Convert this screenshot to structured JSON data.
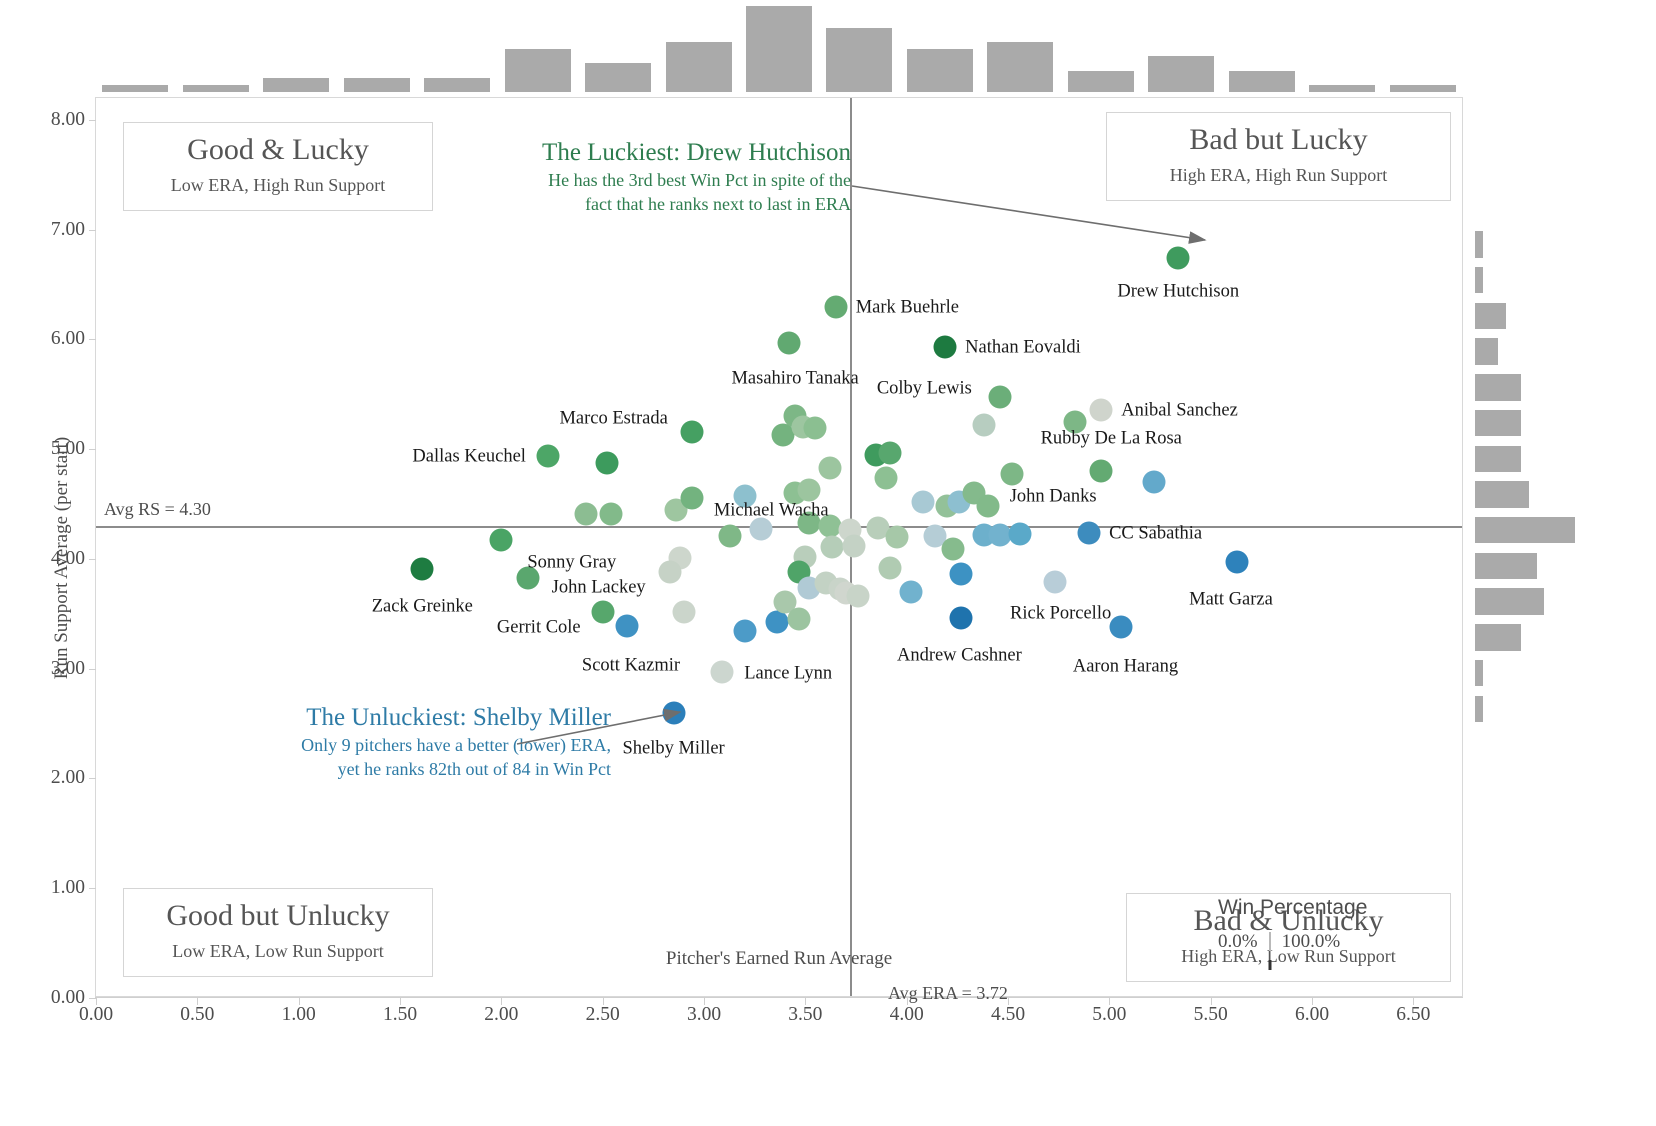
{
  "axes": {
    "x_title": "Pitcher's Earned Run Average",
    "y_title": "Run Support Average (per start)",
    "x_ticks": [
      "0.00",
      "0.50",
      "1.00",
      "1.50",
      "2.00",
      "2.50",
      "3.00",
      "3.50",
      "4.00",
      "4.50",
      "5.00",
      "5.50",
      "6.00",
      "6.50"
    ],
    "y_ticks": [
      "0.00",
      "1.00",
      "2.00",
      "3.00",
      "4.00",
      "5.00",
      "6.00",
      "7.00",
      "8.00"
    ]
  },
  "reference": {
    "avg_rs_label": "Avg RS = 4.30",
    "avg_era_label": "Avg ERA = 3.72",
    "avg_rs_value": 4.3,
    "avg_era_value": 3.72
  },
  "quadrants": [
    {
      "title": "Good & Lucky",
      "subtitle": "Low ERA, High Run Support"
    },
    {
      "title": "Bad but Lucky",
      "subtitle": "High ERA, High Run Support"
    },
    {
      "title": "Good but Unlucky",
      "subtitle": "Low ERA, Low Run Support"
    },
    {
      "title": "Bad & Unlucky",
      "subtitle": "High ERA, Low Run Support"
    }
  ],
  "annotations": {
    "luckiest": {
      "title": "The Luckiest: Drew Hutchison",
      "line1": "He has the 3rd best Win Pct in spite of the",
      "line2": "fact that he ranks next to last in ERA",
      "color": "#2e7d4f"
    },
    "unluckiest": {
      "title": "The Unluckiest: Shelby Miller",
      "line1": "Only 9 pitchers have a better (lower) ERA,",
      "line2": "yet he ranks 82th out of 84 in Win Pct",
      "color": "#2e7ba6"
    }
  },
  "legend": {
    "title": "Win Percentage",
    "min": "0.0%",
    "max": "100.0%",
    "low_color": "#1a5784",
    "mid_color": "#e6e6e1",
    "high_color": "#17713b"
  },
  "chart_data": {
    "type": "scatter",
    "title": "",
    "xlabel": "Pitcher's Earned Run Average",
    "ylabel": "Run Support Average (per start)",
    "xlim": [
      0.0,
      6.75
    ],
    "ylim": [
      0.0,
      8.2
    ],
    "grid": false,
    "color_encoding": "Win Percentage (0.0% to 100.0%), diverging blue-white-green",
    "size_encoding": "constant",
    "reference_lines": {
      "x": 3.72,
      "y": 4.3
    },
    "labeled_points": [
      {
        "name": "Drew Hutchison",
        "era": 5.34,
        "rs": 6.74,
        "win_pct": 0.78,
        "color": "#3f9b5e"
      },
      {
        "name": "Mark Buehrle",
        "era": 3.65,
        "rs": 6.3,
        "win_pct": 0.62,
        "color": "#64ab72"
      },
      {
        "name": "Nathan Eovaldi",
        "era": 4.19,
        "rs": 5.93,
        "win_pct": 0.86,
        "color": "#1d7a40"
      },
      {
        "name": "Masahiro Tanaka",
        "era": 3.42,
        "rs": 5.97,
        "win_pct": 0.63,
        "color": "#61a971"
      },
      {
        "name": "Colby Lewis",
        "era": 4.46,
        "rs": 5.48,
        "win_pct": 0.62,
        "color": "#6bae79"
      },
      {
        "name": "Anibal Sanchez",
        "era": 4.96,
        "rs": 5.36,
        "win_pct": 0.5,
        "color": "#cfd4cc"
      },
      {
        "name": "Marco Estrada",
        "era": 2.94,
        "rs": 5.16,
        "win_pct": 0.76,
        "color": "#45a062"
      },
      {
        "name": "Rubby De La Rosa",
        "era": 4.96,
        "rs": 4.8,
        "win_pct": 0.63,
        "color": "#63aa72"
      },
      {
        "name": "Dallas Keuchel",
        "era": 2.23,
        "rs": 4.94,
        "win_pct": 0.72,
        "color": "#4da667"
      },
      {
        "name": "Michael Wacha",
        "era": 2.94,
        "rs": 4.56,
        "win_pct": 0.64,
        "color": "#73b37f"
      },
      {
        "name": "John Danks",
        "era": 4.4,
        "rs": 4.48,
        "win_pct": 0.58,
        "color": "#82ba8a"
      },
      {
        "name": "Sonny Gray",
        "era": 2.0,
        "rs": 4.17,
        "win_pct": 0.72,
        "color": "#4aa465"
      },
      {
        "name": "CC Sabathia",
        "era": 4.9,
        "rs": 4.24,
        "win_pct": 0.35,
        "color": "#3d8cbe"
      },
      {
        "name": "Zack Greinke",
        "era": 1.61,
        "rs": 3.91,
        "win_pct": 0.85,
        "color": "#1e7c41"
      },
      {
        "name": "John Lackey",
        "era": 2.13,
        "rs": 3.83,
        "win_pct": 0.66,
        "color": "#5aa76e"
      },
      {
        "name": "Matt Garza",
        "era": 5.63,
        "rs": 3.97,
        "win_pct": 0.3,
        "color": "#2e82bb"
      },
      {
        "name": "Gerrit Cole",
        "era": 2.5,
        "rs": 3.52,
        "win_pct": 0.7,
        "color": "#57a76c"
      },
      {
        "name": "Rick Porcello",
        "era": 4.73,
        "rs": 3.79,
        "win_pct": 0.45,
        "color": "#b8cdd8"
      },
      {
        "name": "Scott Kazmir",
        "era": 2.62,
        "rs": 3.39,
        "win_pct": 0.33,
        "color": "#3f92c3"
      },
      {
        "name": "Andrew Cashner",
        "era": 4.27,
        "rs": 3.46,
        "win_pct": 0.25,
        "color": "#1f73ad"
      },
      {
        "name": "Aaron Harang",
        "era": 5.06,
        "rs": 3.38,
        "win_pct": 0.32,
        "color": "#3a8cc0"
      },
      {
        "name": "Lance Lynn",
        "era": 3.09,
        "rs": 2.97,
        "win_pct": 0.48,
        "color": "#ccd6cf"
      },
      {
        "name": "Shelby Miller",
        "era": 2.85,
        "rs": 2.6,
        "win_pct": 0.18,
        "color": "#2b7fba"
      }
    ],
    "unlabeled_points": [
      {
        "era": 2.42,
        "rs": 4.41,
        "color": "#8cbd92"
      },
      {
        "era": 2.54,
        "rs": 4.41,
        "color": "#82ba8a"
      },
      {
        "era": 2.52,
        "rs": 4.87,
        "color": "#3d9b5d"
      },
      {
        "era": 2.86,
        "rs": 4.45,
        "color": "#9ec6a0"
      },
      {
        "era": 2.88,
        "rs": 4.01,
        "color": "#cdd6cc"
      },
      {
        "era": 2.83,
        "rs": 3.88,
        "color": "#c6d2c6"
      },
      {
        "era": 2.9,
        "rs": 3.52,
        "color": "#cbd5cb"
      },
      {
        "era": 3.13,
        "rs": 4.21,
        "color": "#7fb887"
      },
      {
        "era": 3.2,
        "rs": 4.57,
        "color": "#8dc0ce"
      },
      {
        "era": 3.2,
        "rs": 3.34,
        "color": "#4c9bc8"
      },
      {
        "era": 3.28,
        "rs": 4.27,
        "color": "#b6cdd6"
      },
      {
        "era": 3.36,
        "rs": 3.43,
        "color": "#3e92c4"
      },
      {
        "era": 3.39,
        "rs": 5.13,
        "color": "#74b37f"
      },
      {
        "era": 3.45,
        "rs": 5.3,
        "color": "#7db786"
      },
      {
        "era": 3.45,
        "rs": 4.6,
        "color": "#8dc093"
      },
      {
        "era": 3.4,
        "rs": 3.61,
        "color": "#a9c8ab"
      },
      {
        "era": 3.49,
        "rs": 5.2,
        "color": "#9dc6a0"
      },
      {
        "era": 3.52,
        "rs": 4.63,
        "color": "#9cc59f"
      },
      {
        "era": 3.55,
        "rs": 5.19,
        "color": "#8bbf91"
      },
      {
        "era": 3.52,
        "rs": 4.33,
        "color": "#7db786"
      },
      {
        "era": 3.5,
        "rs": 4.02,
        "color": "#b9cebb"
      },
      {
        "era": 3.47,
        "rs": 3.88,
        "color": "#4fa468"
      },
      {
        "era": 3.52,
        "rs": 3.74,
        "color": "#b0cad5"
      },
      {
        "era": 3.47,
        "rs": 3.45,
        "color": "#9cc4a0"
      },
      {
        "era": 3.62,
        "rs": 4.83,
        "color": "#9cc59f"
      },
      {
        "era": 3.62,
        "rs": 4.3,
        "color": "#8fc195"
      },
      {
        "era": 3.63,
        "rs": 4.11,
        "color": "#b5cdb8"
      },
      {
        "era": 3.6,
        "rs": 3.78,
        "color": "#c3d2c4"
      },
      {
        "era": 3.67,
        "rs": 3.73,
        "color": "#c9d4c9"
      },
      {
        "era": 3.7,
        "rs": 3.69,
        "color": "#d0d6ce"
      },
      {
        "era": 3.72,
        "rs": 4.26,
        "color": "#cdd6cc"
      },
      {
        "era": 3.74,
        "rs": 4.12,
        "color": "#c4d2c5"
      },
      {
        "era": 3.76,
        "rs": 3.66,
        "color": "#c8d4c8"
      },
      {
        "era": 3.85,
        "rs": 4.95,
        "color": "#3f9b5e"
      },
      {
        "era": 3.92,
        "rs": 4.97,
        "color": "#58a76e"
      },
      {
        "era": 3.9,
        "rs": 4.74,
        "color": "#8dc093"
      },
      {
        "era": 3.86,
        "rs": 4.28,
        "color": "#b8ceba"
      },
      {
        "era": 3.95,
        "rs": 4.2,
        "color": "#a6c8a8"
      },
      {
        "era": 3.92,
        "rs": 3.92,
        "color": "#b0cbb2"
      },
      {
        "era": 4.02,
        "rs": 3.7,
        "color": "#71b2ce"
      },
      {
        "era": 4.08,
        "rs": 4.52,
        "color": "#a8c9d4"
      },
      {
        "era": 4.14,
        "rs": 4.21,
        "color": "#b5cdd6"
      },
      {
        "era": 4.2,
        "rs": 4.48,
        "color": "#93c199"
      },
      {
        "era": 4.26,
        "rs": 4.52,
        "color": "#8dbfd0"
      },
      {
        "era": 4.23,
        "rs": 4.09,
        "color": "#86bb8d"
      },
      {
        "era": 4.27,
        "rs": 3.86,
        "color": "#3d92c3"
      },
      {
        "era": 4.33,
        "rs": 4.6,
        "color": "#84ba8c"
      },
      {
        "era": 4.38,
        "rs": 5.22,
        "color": "#b7cdc0"
      },
      {
        "era": 4.38,
        "rs": 4.22,
        "color": "#6db0cc"
      },
      {
        "era": 4.46,
        "rs": 4.22,
        "color": "#72b2ce"
      },
      {
        "era": 4.52,
        "rs": 4.77,
        "color": "#7db786"
      },
      {
        "era": 4.56,
        "rs": 4.23,
        "color": "#5aa9c9"
      },
      {
        "era": 4.83,
        "rs": 5.25,
        "color": "#7db786"
      },
      {
        "era": 5.22,
        "rs": 4.7,
        "color": "#63a9cb"
      }
    ],
    "hist_top": {
      "orientation": "vertical",
      "axis": "ERA",
      "bin_counts": [
        1,
        1,
        2,
        2,
        2,
        6,
        4,
        7,
        12,
        9,
        6,
        7,
        3,
        5,
        3,
        1,
        1
      ]
    },
    "hist_right": {
      "orientation": "horizontal",
      "axis": "Run Support Average",
      "bin_counts": [
        1,
        1,
        4,
        3,
        6,
        6,
        6,
        7,
        13,
        8,
        9,
        6,
        1,
        1
      ]
    }
  }
}
